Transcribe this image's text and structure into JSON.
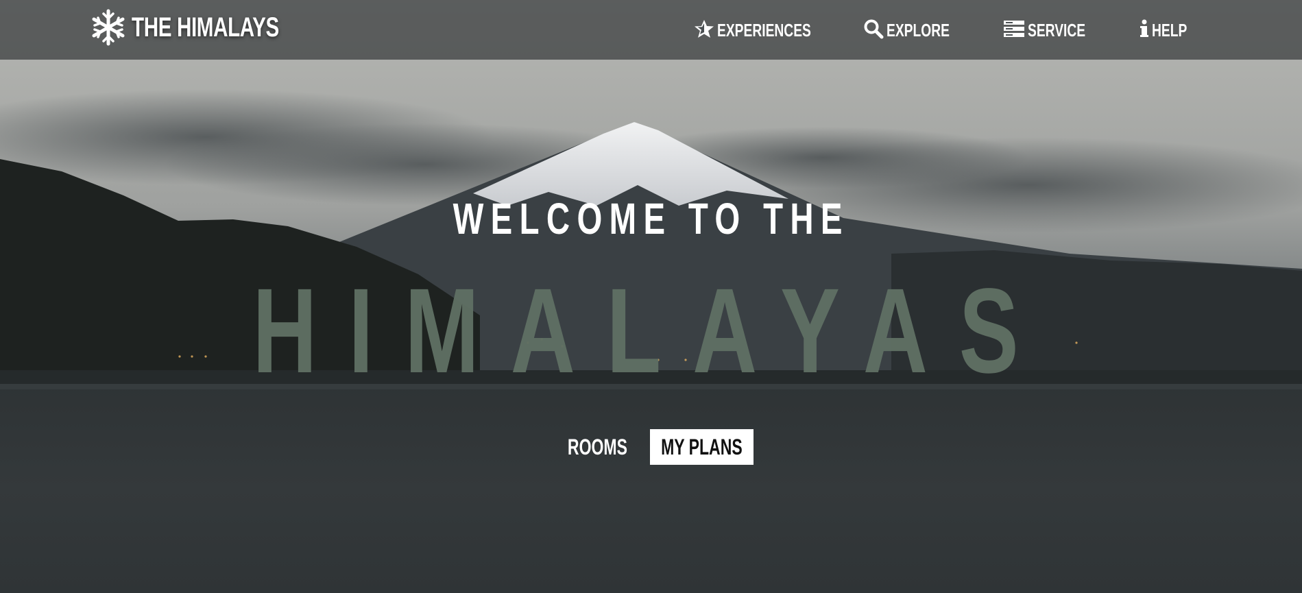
{
  "brand": {
    "name": "THE HIMALAYS",
    "icon": "snowflake-icon"
  },
  "nav": {
    "items": [
      {
        "label": "EXPERIENCES",
        "icon": "star-icon"
      },
      {
        "label": "EXPLORE",
        "icon": "search-icon"
      },
      {
        "label": "SERVICE",
        "icon": "server-icon"
      },
      {
        "label": "HELP",
        "icon": "info-icon"
      }
    ]
  },
  "hero": {
    "line1": "WELCOME TO THE",
    "line2": "HIMALAYAS",
    "line2_color": "#5f6f63"
  },
  "actions": {
    "rooms_label": "ROOMS",
    "plans_label": "MY PLANS"
  }
}
